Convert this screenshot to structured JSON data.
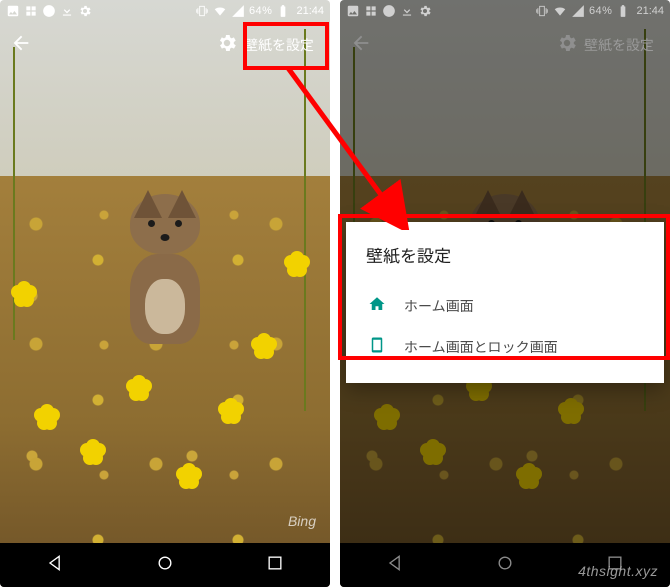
{
  "status": {
    "battery_text": "64%",
    "clock": "21:44"
  },
  "appbar": {
    "set_wallpaper_label": "壁紙を設定"
  },
  "dialog": {
    "title": "壁紙を設定",
    "option_home": "ホーム画面",
    "option_home_and_lock": "ホーム画面とロック画面"
  },
  "branding": {
    "bing": "Bing"
  },
  "watermark": "4thsight.xyz",
  "colors": {
    "highlight": "#ff0000",
    "accent": "#009688"
  }
}
